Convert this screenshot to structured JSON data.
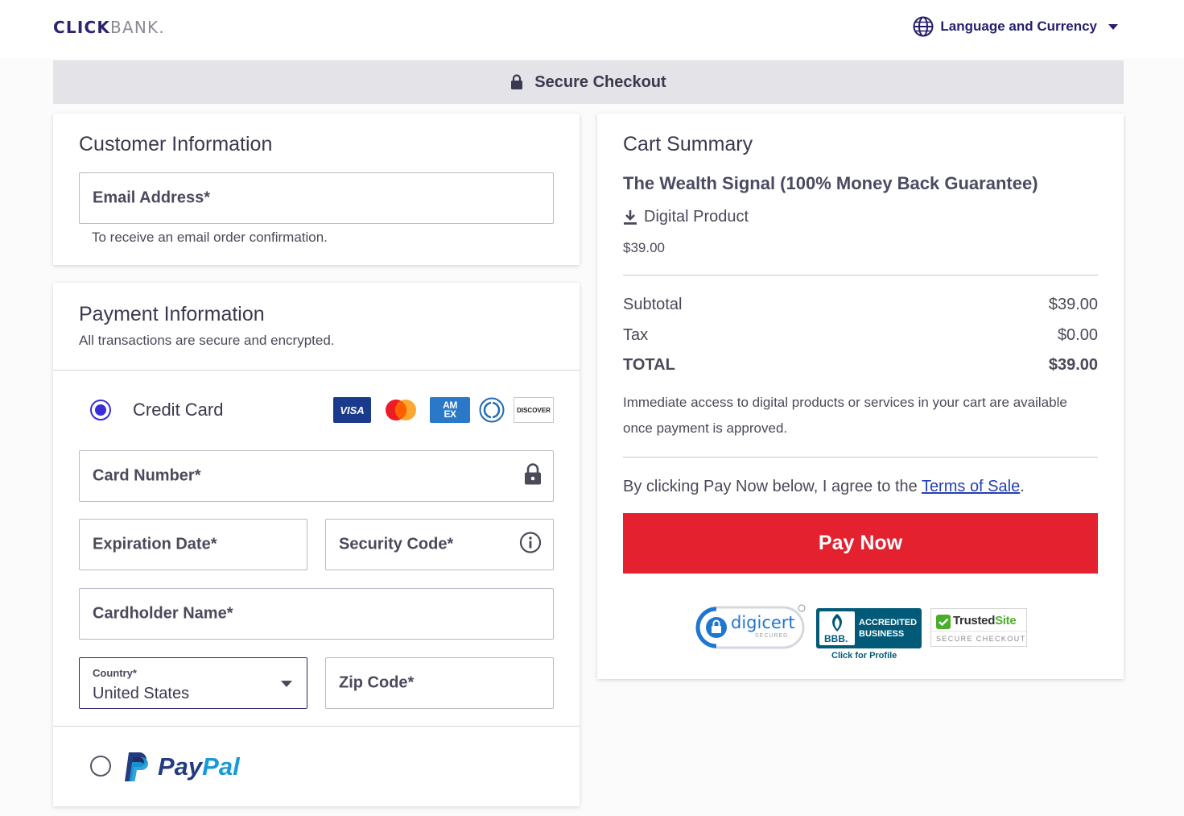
{
  "header": {
    "logo_click": "CLICK",
    "logo_bank": "BANK.",
    "language_label": "Language and Currency"
  },
  "secure_bar": {
    "label": "Secure Checkout"
  },
  "customer": {
    "title": "Customer Information",
    "email_placeholder": "Email Address*",
    "email_helper": "To receive an email order confirmation."
  },
  "payment": {
    "title": "Payment Information",
    "subtitle": "All transactions are secure and encrypted.",
    "credit_card_label": "Credit Card",
    "card_brands": [
      "VISA",
      "AM EX",
      "DISCOVER"
    ],
    "card_number_placeholder": "Card Number*",
    "expiration_placeholder": "Expiration Date*",
    "security_code_placeholder": "Security Code*",
    "cardholder_placeholder": "Cardholder Name*",
    "country_label": "Country*",
    "country_value": "United States",
    "zip_placeholder": "Zip Code*",
    "paypal_label_1": "Pay",
    "paypal_label_2": "Pal"
  },
  "cart": {
    "title": "Cart Summary",
    "product_name": "The Wealth Signal (100% Money Back Guarantee)",
    "product_type": "Digital Product",
    "product_price": "$39.00",
    "subtotal_label": "Subtotal",
    "subtotal_value": "$39.00",
    "tax_label": "Tax",
    "tax_value": "$0.00",
    "total_label": "TOTAL",
    "total_value": "$39.00",
    "access_note": "Immediate access to digital products or services in your cart are available once payment is approved.",
    "terms_prefix": "By clicking Pay Now below, I agree to the ",
    "terms_link": "Terms of Sale",
    "terms_suffix": ".",
    "pay_button": "Pay Now"
  },
  "badges": {
    "digicert": "digicert",
    "digicert_sub": "SECURED",
    "bbb_line1": "ACCREDITED",
    "bbb_line2": "BUSINESS",
    "bbb_mark": "BBB.",
    "bbb_profile": "Click for Profile",
    "trusted_a": "Trusted",
    "trusted_b": "Site",
    "trusted_sub": "SECURE CHECKOUT"
  },
  "colors": {
    "brand": "#2b2470",
    "accent_radio": "#3a2fd6",
    "pay_button": "#e3212f",
    "link": "#2340b6"
  }
}
